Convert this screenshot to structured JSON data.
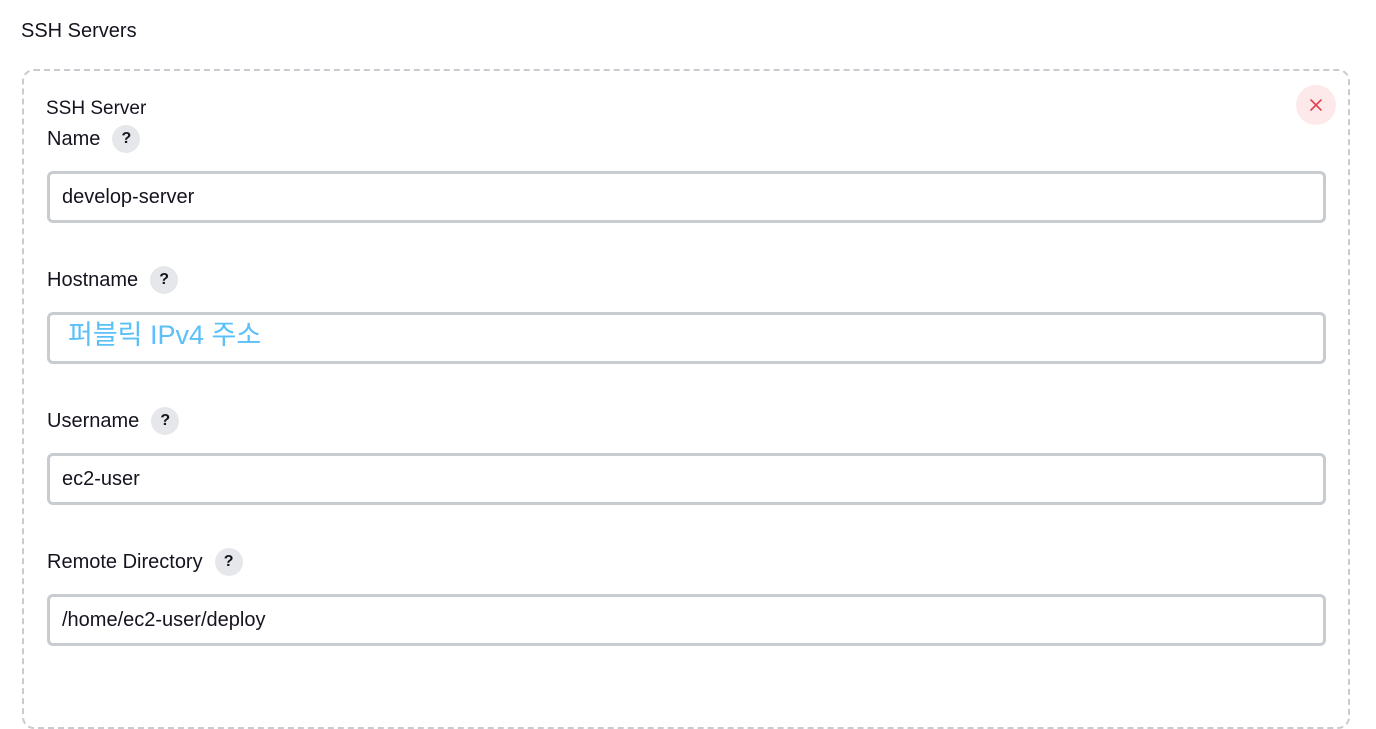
{
  "section": {
    "title": "SSH Servers"
  },
  "server": {
    "heading": "SSH Server",
    "close_icon": "close-icon",
    "help_icon_glyph": "?",
    "fields": [
      {
        "label": "Name",
        "value": "develop-server",
        "placeholder": ""
      },
      {
        "label": "Hostname",
        "value": "",
        "placeholder": "퍼블릭 IPv4 주소"
      },
      {
        "label": "Username",
        "value": "ec2-user",
        "placeholder": ""
      },
      {
        "label": "Remote Directory",
        "value": "/home/ec2-user/deploy",
        "placeholder": ""
      }
    ]
  },
  "colors": {
    "close_bg": "#fde9ea",
    "close_x": "#e0434f",
    "placeholder": "#5bc0f8",
    "input_border": "#c8ccd1",
    "card_border": "#c9cbd0"
  }
}
